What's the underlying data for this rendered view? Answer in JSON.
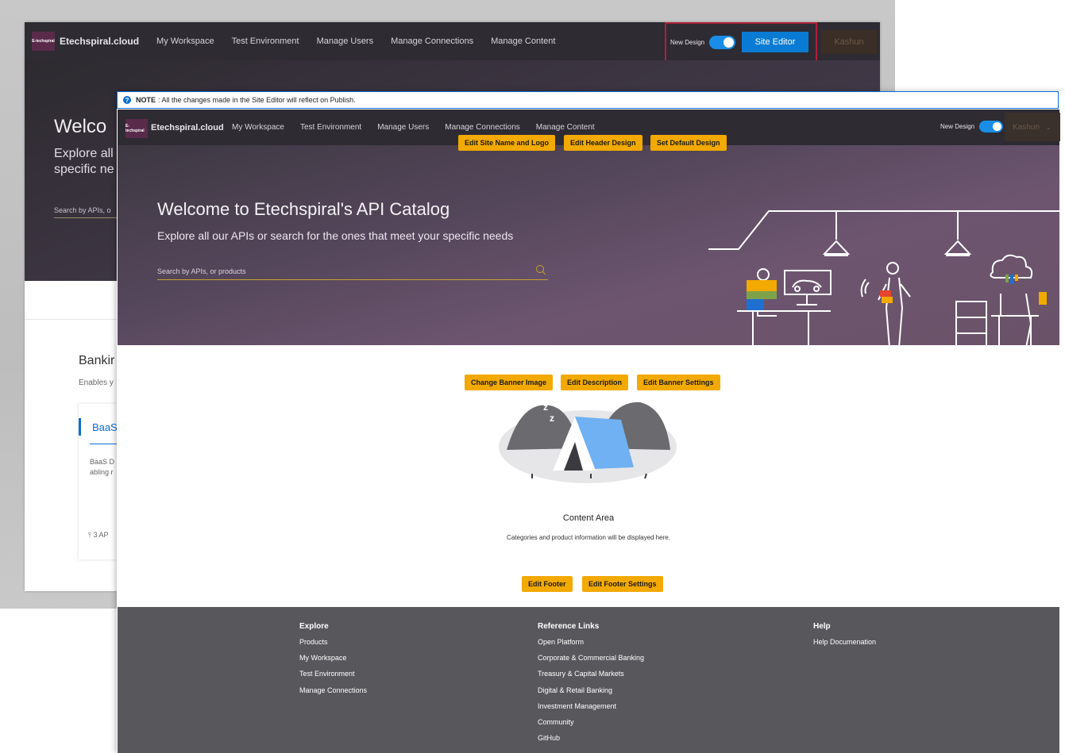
{
  "background_shot": {
    "brand": "Etechspiral.cloud",
    "logo_text": "E-techspiral",
    "nav": [
      "My Workspace",
      "Test Environment",
      "Manage Users",
      "Manage Connections",
      "Manage Content"
    ],
    "new_design_label": "New Design",
    "site_editor_label": "Site Editor",
    "user_label": "Kashun",
    "hero_title": "Welco",
    "hero_subtitle": "Explore all specific ne",
    "search_placeholder": "Search by APIs, o",
    "section_title": "Bankir",
    "section_subtitle": "Enables y",
    "card_title": "BaaS",
    "card_desc": "BaaS D abling r",
    "card_apis": "3 AP"
  },
  "note": {
    "label": "NOTE",
    "text": ": All the changes made in the Site Editor will reflect on Publish."
  },
  "foreground": {
    "brand": "Etechspiral.cloud",
    "logo_text": "E-techspiral",
    "nav": [
      "My Workspace",
      "Test Environment",
      "Manage Users",
      "Manage Connections",
      "Manage Content"
    ],
    "new_design_label": "New Design",
    "user_label": "Kashun",
    "hero_title": "Welcome to Etechspiral's API Catalog",
    "hero_subtitle": "Explore all our APIs or search for the ones that meet your specific needs",
    "search_placeholder": "Search by APIs, or products",
    "content_title": "Content Area",
    "content_subtitle": "Categories and product information will be displayed here."
  },
  "edit_buttons": {
    "site_name_logo": "Edit Site Name and Logo",
    "header_design": "Edit Header Design",
    "default_design": "Set Default Design",
    "banner_image": "Change Banner Image",
    "description": "Edit Description",
    "banner_settings": "Edit Banner Settings",
    "footer": "Edit Footer",
    "footer_settings": "Edit Footer Settings"
  },
  "footer": {
    "explore": {
      "heading": "Explore",
      "links": [
        "Products",
        "My Workspace",
        "Test Environment",
        "Manage Connections"
      ]
    },
    "reference": {
      "heading": "Reference Links",
      "links": [
        "Open Platform",
        "Corporate & Commercial Banking",
        "Treasury & Capital Markets",
        "Digital & Retail Banking",
        "Investment Management",
        "Community",
        "GitHub"
      ]
    },
    "help": {
      "heading": "Help",
      "links": [
        "Help Documenation"
      ]
    }
  },
  "colors": {
    "header_bg": "#2e2b33",
    "accent_blue": "#0a7bd4",
    "edit_button": "#f2a900",
    "highlight_border": "#b0203a",
    "footer_bg": "#58575b"
  }
}
